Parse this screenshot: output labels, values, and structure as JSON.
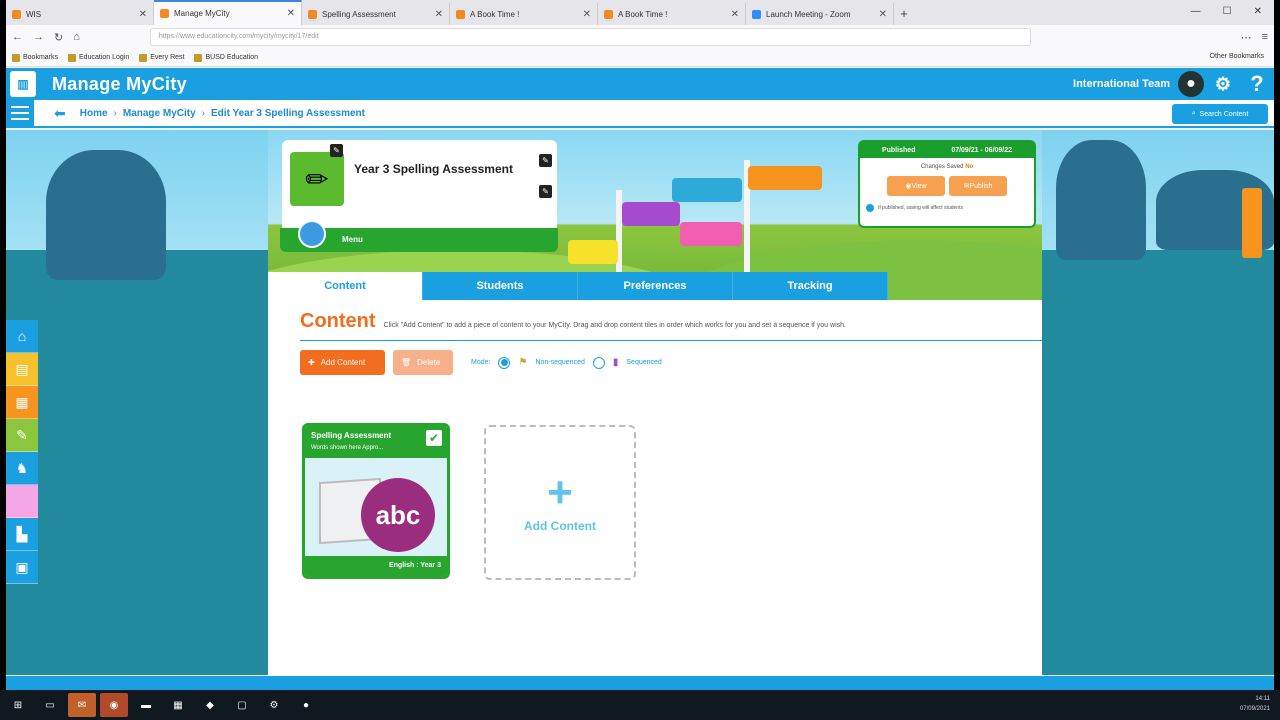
{
  "browser": {
    "tabs": [
      {
        "title": "WIS",
        "active": false
      },
      {
        "title": "Manage MyCity",
        "active": true
      },
      {
        "title": "Spelling Assessment",
        "active": false
      },
      {
        "title": "A Book Time !",
        "active": false
      },
      {
        "title": "A Book Time !",
        "active": false
      },
      {
        "title": "Launch Meeting - Zoom",
        "active": false
      }
    ],
    "new_tab": "+",
    "url": "https://www.educationcity.com/mycity/mycity/17/edit",
    "bookmarks": [
      "Bookmarks",
      "Education Login",
      "Every Rest",
      "BUSD Education"
    ],
    "other_bookmarks": "Other Bookmarks"
  },
  "app": {
    "title": "Manage MyCity",
    "team": "International Team",
    "help": "?"
  },
  "breadcrumb": {
    "items": [
      "Home",
      "Manage MyCity",
      "Edit Year 3 Spelling Assessment"
    ],
    "separator": "›"
  },
  "search_button": "Search Content",
  "info_card": {
    "title": "Year 3 Spelling Assessment",
    "footer": "Menu"
  },
  "publish": {
    "status": "Published",
    "dates": "07/09/21 - 06/09/22",
    "changes_label": "Changes Saved",
    "changes_value": "No",
    "view": "View",
    "publish": "Publish",
    "note": "If published, saving will affect students"
  },
  "tabs": [
    "Content",
    "Students",
    "Preferences",
    "Tracking"
  ],
  "content": {
    "heading": "Content",
    "description": "Click \"Add Content\" to add a piece of content to your MyCity. Drag and drop content tiles in order which works for you and set a sequence if you wish.",
    "add_button": "Add Content",
    "delete_button": "Delete",
    "mode_label": "Mode:",
    "mode_options": [
      "Non-sequenced",
      "Sequenced"
    ]
  },
  "tile": {
    "title": "Spelling Assessment",
    "subtitle": "Words shown here Appro...",
    "art": "abc",
    "footer": "English : Year 3"
  },
  "add_tile": {
    "plus": "+",
    "label": "Add Content"
  },
  "taskbar": {
    "time": "14:11",
    "date": "07/09/2021"
  }
}
